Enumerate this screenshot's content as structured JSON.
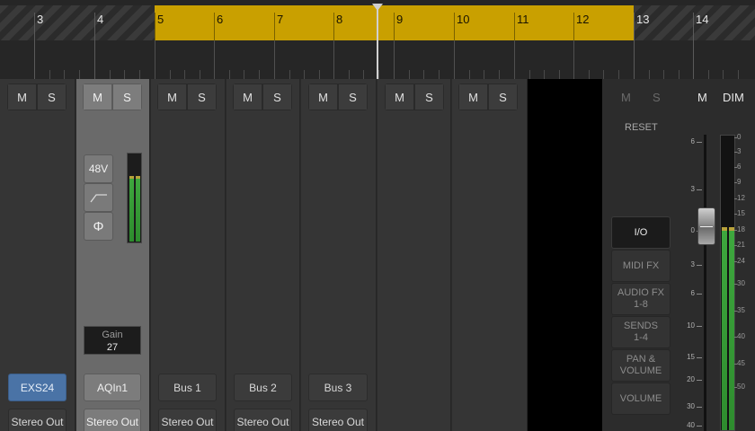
{
  "ruler": {
    "bars": [
      "3",
      "4",
      "5",
      "6",
      "7",
      "8",
      "9",
      "10",
      "11",
      "12",
      "13",
      "14"
    ]
  },
  "strips": [
    {
      "mute": "M",
      "solo": "S",
      "plugin": "EXS24",
      "output": "Stereo Out"
    },
    {
      "mute": "M",
      "solo": "S",
      "plugin": "AQIn1",
      "output": "Stereo Out",
      "selected": true
    },
    {
      "mute": "M",
      "solo": "S",
      "plugin": "Bus 1",
      "output": "Stereo Out"
    },
    {
      "mute": "M",
      "solo": "S",
      "plugin": "Bus 2",
      "output": "Stereo Out"
    },
    {
      "mute": "M",
      "solo": "S",
      "plugin": "Bus 3",
      "output": "Stereo Out"
    },
    {
      "mute": "M",
      "solo": "S"
    },
    {
      "mute": "M",
      "solo": "S"
    }
  ],
  "input": {
    "phantom": "48V",
    "phase": "Φ",
    "gain_label": "Gain",
    "gain_value": "27"
  },
  "monitor": {
    "mute": "M",
    "solo": "S",
    "master_mute": "M",
    "dim": "DIM",
    "reset": "RESET",
    "menu": [
      {
        "label": "I/O",
        "active": true
      },
      {
        "label": "MIDI FX"
      },
      {
        "label": "AUDIO FX\n1-8"
      },
      {
        "label": "SENDS\n1-4"
      },
      {
        "label": "PAN &\nVOLUME"
      },
      {
        "label": "VOLUME"
      }
    ],
    "fader_scale": [
      "6",
      "3",
      "0",
      "3",
      "6",
      "10",
      "15",
      "20",
      "30",
      "40"
    ],
    "meter_scale": [
      "0",
      "3",
      "6",
      "9",
      "12",
      "15",
      "18",
      "21",
      "24",
      "30",
      "35",
      "40",
      "45",
      "50"
    ]
  },
  "colors": {
    "cycle": "#c9a000",
    "selected_strip": "#6a6a6a",
    "plugin_blue": "#4a73a6",
    "meter_green": "#3ea83e"
  }
}
